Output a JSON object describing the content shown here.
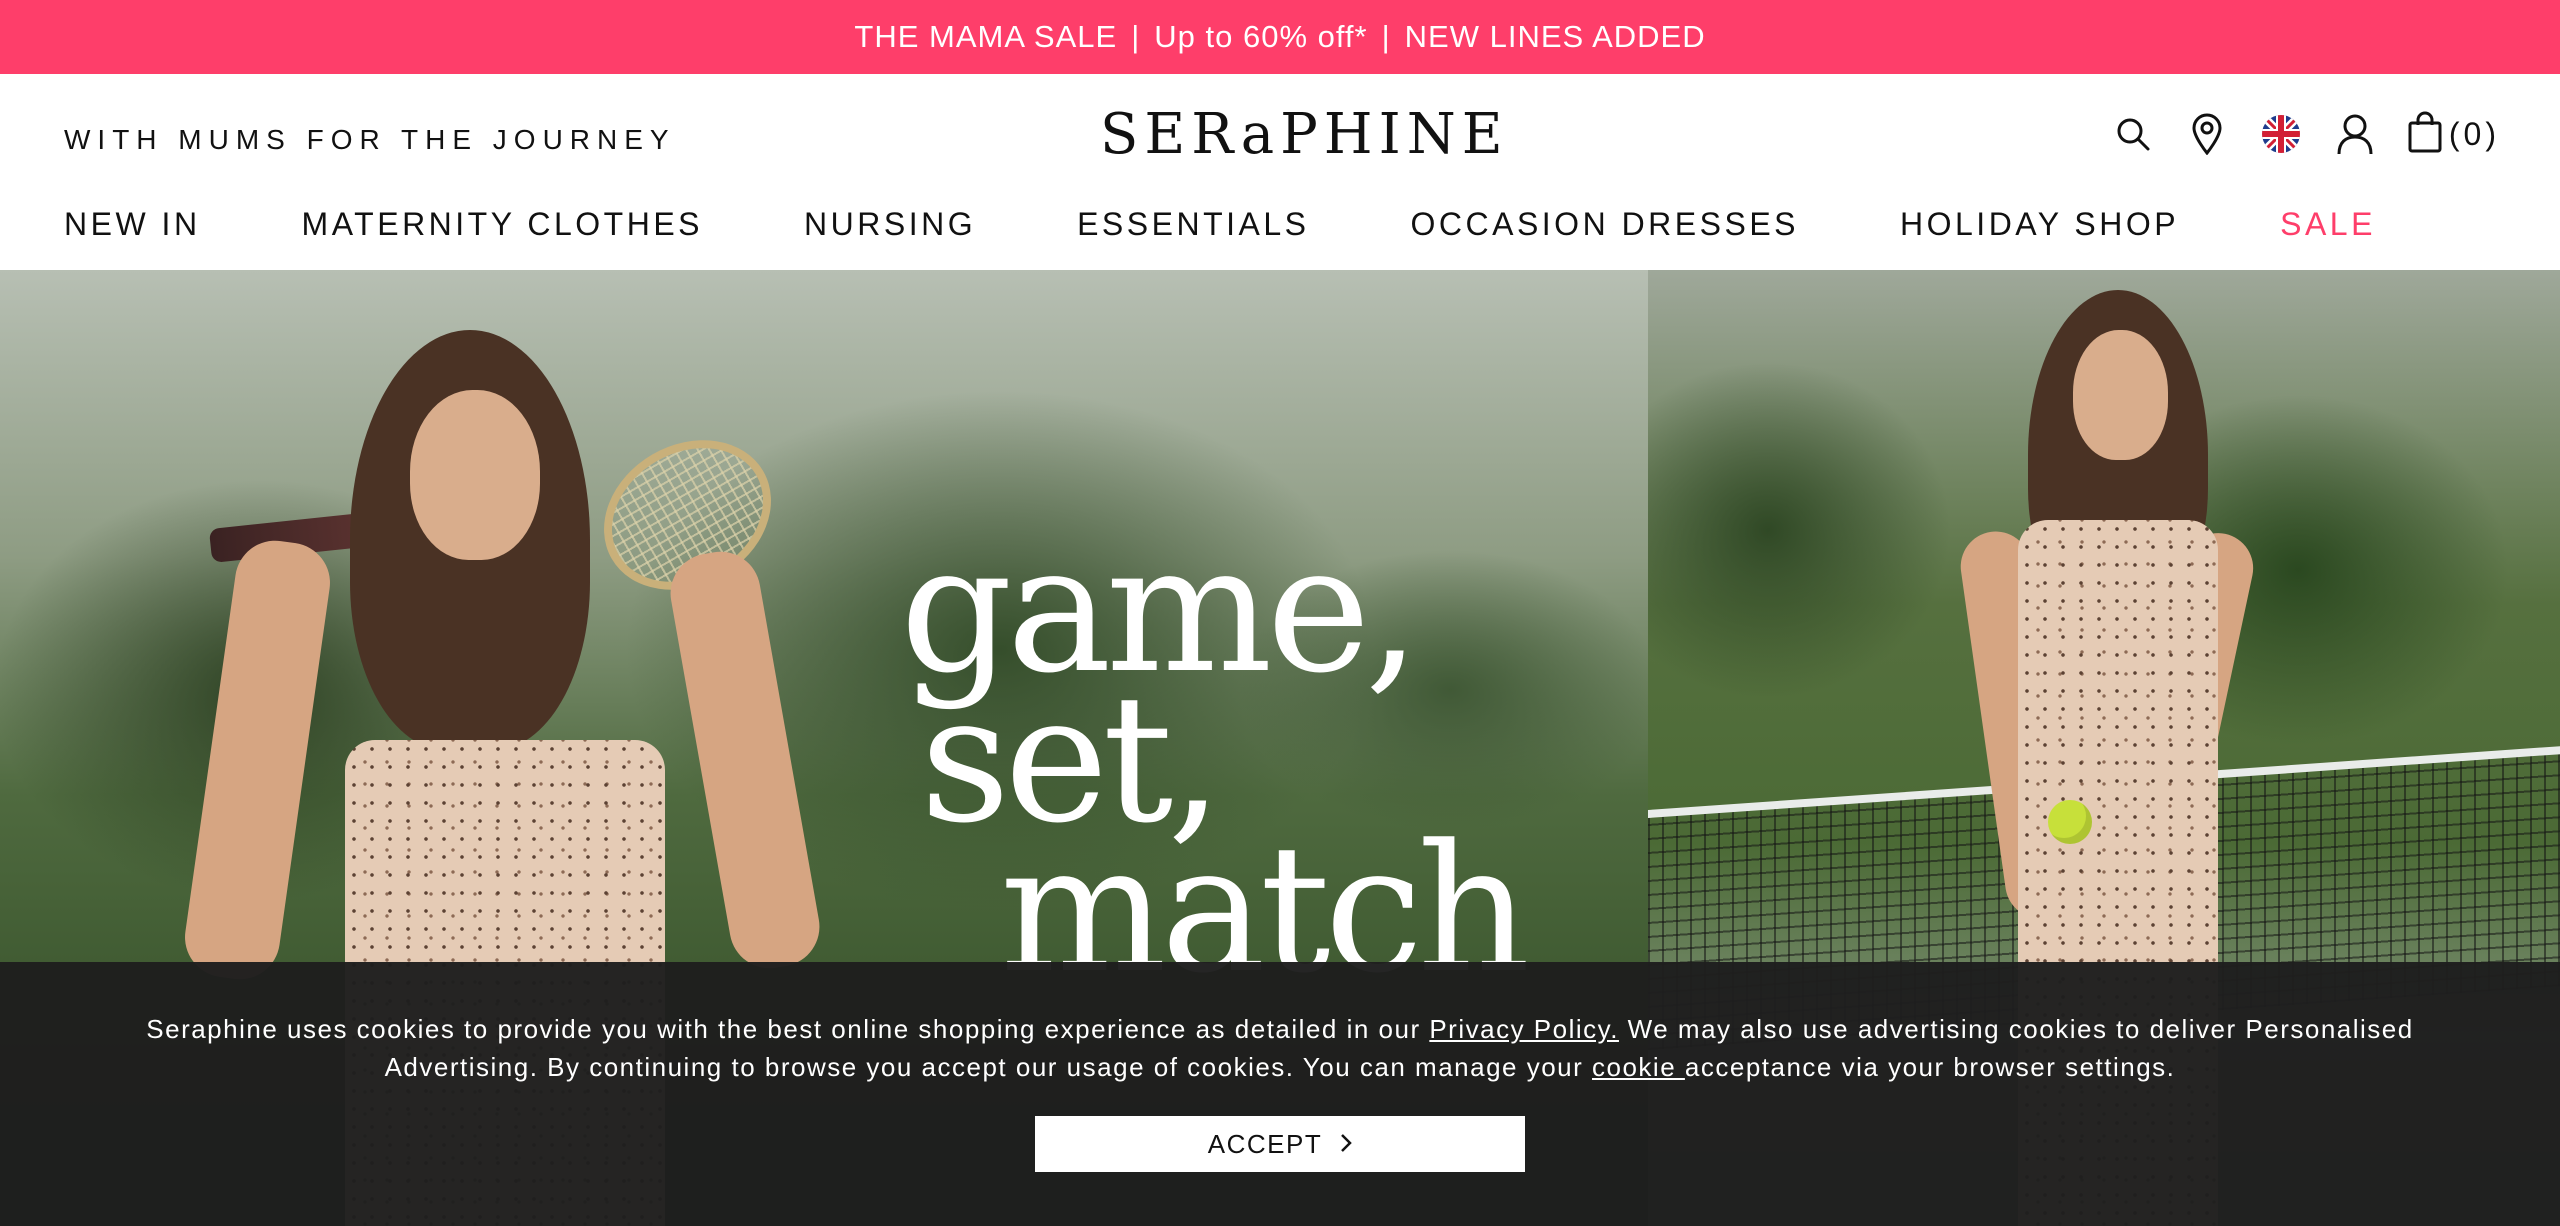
{
  "promo": {
    "part1": "THE MAMA SALE",
    "separator": "|",
    "part2": "Up to 60% off*",
    "part3": "NEW LINES ADDED",
    "bg_color": "#fe3e6a"
  },
  "header": {
    "tagline": "WITH MUMS FOR THE JOURNEY",
    "logo": "SERaPHINE",
    "icons": {
      "search": "search-icon",
      "store": "location-pin-icon",
      "country": "uk-flag-icon",
      "account": "user-icon",
      "cart": "shopping-bag-icon"
    },
    "cart_count": "(0)"
  },
  "nav": {
    "items": [
      {
        "label": "NEW IN"
      },
      {
        "label": "MATERNITY CLOTHES"
      },
      {
        "label": "NURSING"
      },
      {
        "label": "ESSENTIALS"
      },
      {
        "label": "OCCASION DRESSES"
      },
      {
        "label": "HOLIDAY SHOP"
      },
      {
        "label": "SALE"
      }
    ],
    "sale_color": "#fe3e6a"
  },
  "hero": {
    "line1": "game,",
    "line2": "set,",
    "line3": "match"
  },
  "cookie": {
    "text_before_policy": "Seraphine uses cookies to provide you with the best online shopping experience as detailed in our ",
    "policy_link": "Privacy Policy.",
    "text_after_policy": " We may also use advertising cookies to deliver Personalised Advertising. By continuing to browse you accept our usage of cookies. You can manage your ",
    "cookie_link": "cookie ",
    "text_end": "acceptance via your browser settings.",
    "accept_label": "ACCEPT",
    "accept_icon": "chevron-right-icon"
  }
}
